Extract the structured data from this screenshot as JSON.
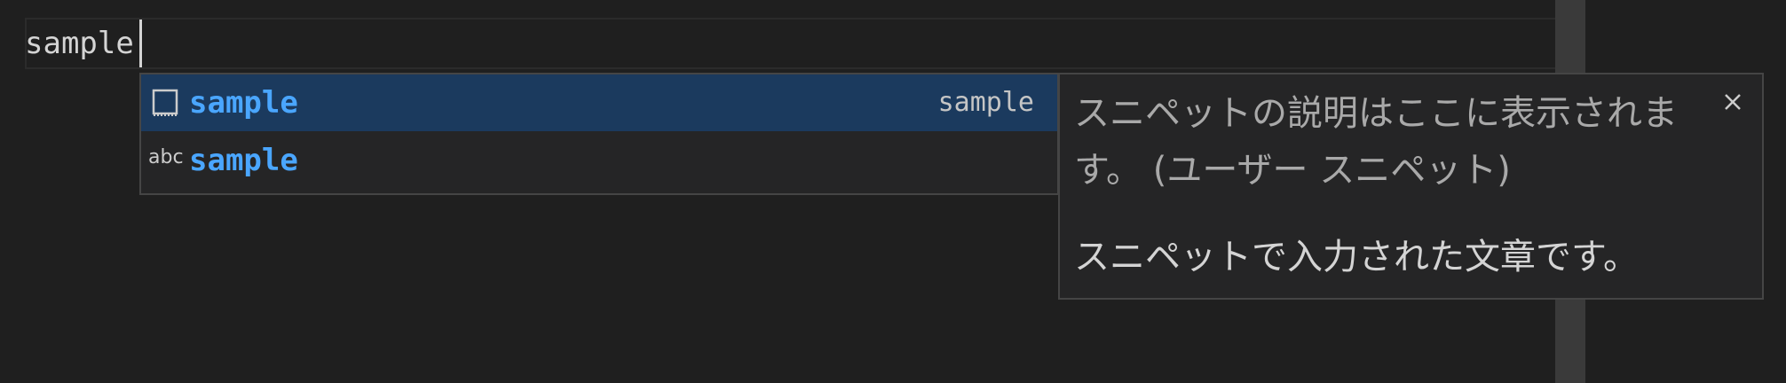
{
  "editor": {
    "text": "sample"
  },
  "suggestions": [
    {
      "icon": "snippet-icon",
      "label": "sample",
      "detail": "sample",
      "selected": true
    },
    {
      "icon": "text-icon",
      "icon_text": "abc",
      "label": "sample",
      "selected": false
    }
  ],
  "details": {
    "header": "スニペットの説明はここに表示されます。 (ユーザー スニペット)",
    "body": "スニペットで入力された文章です。",
    "close_icon": "close-icon"
  },
  "colors": {
    "background": "#1f1f1f",
    "selected_row": "#1b3a5e",
    "highlight_label": "#4aa6ff",
    "widget_bg": "#252526",
    "widget_border": "#454545"
  }
}
